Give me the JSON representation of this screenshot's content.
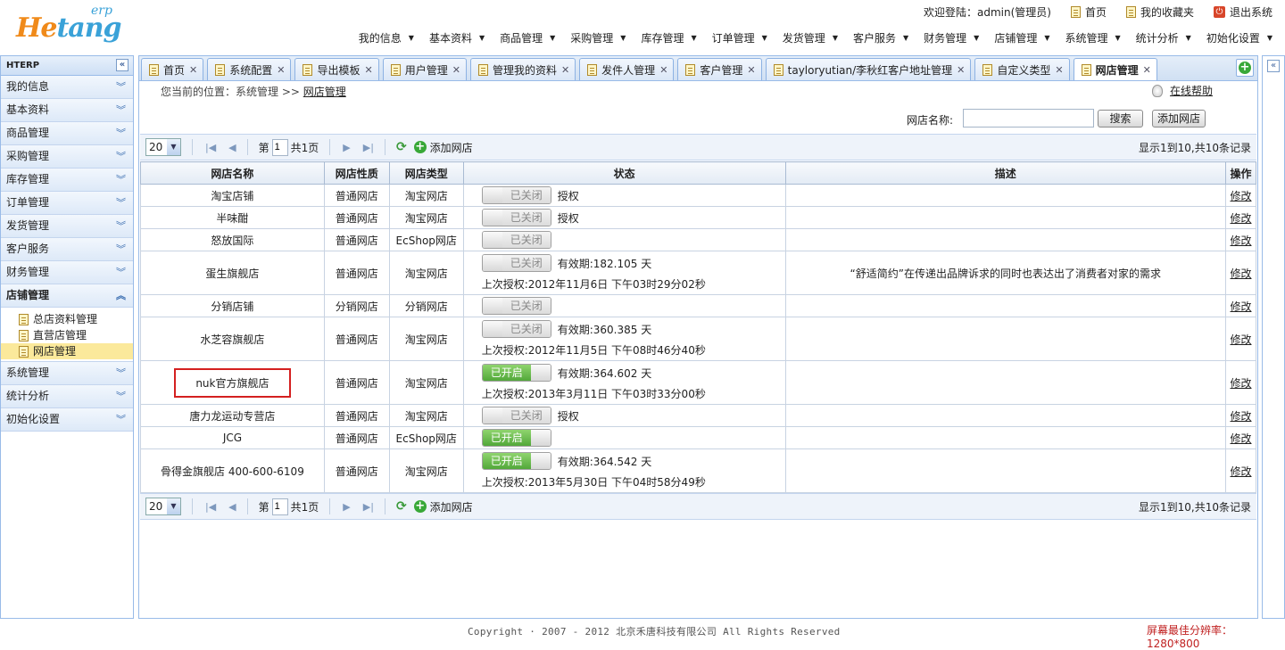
{
  "logo": {
    "brand_part1": "He",
    "brand_part2": "tang",
    "suffix": "erp"
  },
  "toplinks": {
    "welcome": "欢迎登陆：admin(管理员)",
    "home": "首页",
    "favorites": "我的收藏夹",
    "logout": "退出系统"
  },
  "topnav": [
    "我的信息",
    "基本资料",
    "商品管理",
    "采购管理",
    "库存管理",
    "订单管理",
    "发货管理",
    "客户服务",
    "财务管理",
    "店铺管理",
    "系统管理",
    "统计分析",
    "初始化设置"
  ],
  "sidebar": {
    "title": "HTERP",
    "sections_before": [
      "我的信息",
      "基本资料",
      "商品管理",
      "采购管理",
      "库存管理",
      "订单管理",
      "发货管理",
      "客户服务",
      "财务管理"
    ],
    "open_section": "店铺管理",
    "sub_items": [
      "总店资料管理",
      "直营店管理",
      "网店管理"
    ],
    "sections_after": [
      "系统管理",
      "统计分析",
      "初始化设置"
    ]
  },
  "tabs": [
    "首页",
    "系统配置",
    "导出模板",
    "用户管理",
    "管理我的资料",
    "发件人管理",
    "客户管理",
    "tayloryutian/李秋红客户地址管理",
    "自定义类型",
    "网店管理"
  ],
  "breadcrumb": {
    "prefix": "您当前的位置：系统管理 >> ",
    "current": "网店管理"
  },
  "help": "在线帮助",
  "search": {
    "label": "网店名称:",
    "value": "",
    "search_btn": "搜索",
    "add_btn": "添加网店"
  },
  "pager": {
    "page_size": "20",
    "page_label": "第",
    "page_value": "1",
    "total_pages": "共1页",
    "add_label": "添加网店",
    "info": "显示1到10,共10条记录"
  },
  "table": {
    "headers": [
      "网店名称",
      "网店性质",
      "网店类型",
      "状态",
      "描述",
      "操作"
    ],
    "rows": [
      {
        "name": "淘宝店铺",
        "nature": "普通网店",
        "type": "淘宝网店",
        "toggle": "已关闭",
        "on": false,
        "extra": "授权",
        "line2": "",
        "desc": "",
        "op": "修改"
      },
      {
        "name": "半味酣",
        "nature": "普通网店",
        "type": "淘宝网店",
        "toggle": "已关闭",
        "on": false,
        "extra": "授权",
        "line2": "",
        "desc": "",
        "op": "修改"
      },
      {
        "name": "怒放国际",
        "nature": "普通网店",
        "type": "EcShop网店",
        "toggle": "已关闭",
        "on": false,
        "extra": "",
        "line2": "",
        "desc": "",
        "op": "修改"
      },
      {
        "name": "蛋生旗舰店",
        "nature": "普通网店",
        "type": "淘宝网店",
        "toggle": "已关闭",
        "on": false,
        "extra": "有效期:182.105 天",
        "line2": "上次授权:2012年11月6日 下午03时29分02秒",
        "desc": "“舒适简约”在传递出品牌诉求的同时也表达出了消费者对家的需求",
        "op": "修改"
      },
      {
        "name": "分销店铺",
        "nature": "分销网店",
        "type": "分销网店",
        "toggle": "已关闭",
        "on": false,
        "extra": "",
        "line2": "",
        "desc": "",
        "op": "修改"
      },
      {
        "name": "水芝容旗舰店",
        "nature": "普通网店",
        "type": "淘宝网店",
        "toggle": "已关闭",
        "on": false,
        "extra": "有效期:360.385 天",
        "line2": "上次授权:2012年11月5日 下午08时46分40秒",
        "desc": "",
        "op": "修改"
      },
      {
        "name": "nuk官方旗舰店",
        "nature": "普通网店",
        "type": "淘宝网店",
        "toggle": "已开启",
        "on": true,
        "extra": "有效期:364.602 天",
        "line2": "上次授权:2013年3月11日 下午03时33分00秒",
        "desc": "",
        "op": "修改",
        "highlight": true
      },
      {
        "name": "唐力龙运动专营店",
        "nature": "普通网店",
        "type": "淘宝网店",
        "toggle": "已关闭",
        "on": false,
        "extra": "授权",
        "line2": "",
        "desc": "",
        "op": "修改"
      },
      {
        "name": "JCG",
        "nature": "普通网店",
        "type": "EcShop网店",
        "toggle": "已开启",
        "on": true,
        "extra": "",
        "line2": "",
        "desc": "",
        "op": "修改"
      },
      {
        "name": "骨得金旗舰店 400-600-6109",
        "nature": "普通网店",
        "type": "淘宝网店",
        "toggle": "已开启",
        "on": true,
        "extra": "有效期:364.542 天",
        "line2": "上次授权:2013年5月30日 下午04时58分49秒",
        "desc": "",
        "op": "修改"
      }
    ]
  },
  "footer": {
    "copyright": "Copyright · 2007 - 2012 北京禾唐科技有限公司 All Rights Reserved",
    "watermark": "屏幕最佳分辨率：1280*800"
  }
}
